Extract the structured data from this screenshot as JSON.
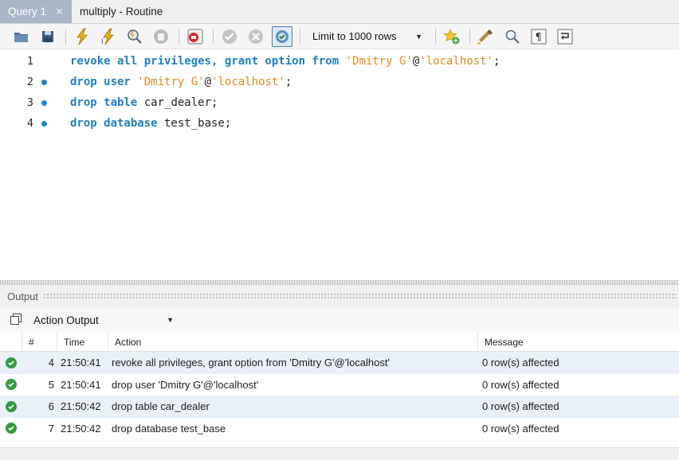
{
  "tabs": [
    {
      "label": "Query 1",
      "active": true
    },
    {
      "label": "multiply - Routine",
      "active": false
    }
  ],
  "toolbar": {
    "limit_select": "Limit to 1000 rows",
    "icons": [
      "folder-open-icon",
      "save-icon",
      "execute-icon",
      "execute-current-icon",
      "explain-icon",
      "stop-icon",
      "toggle-error-stop-icon",
      "commit-icon",
      "rollback-icon",
      "autocommit-icon",
      "add-snippet-icon",
      "beautify-icon",
      "find-icon",
      "invisible-chars-icon",
      "wrap-lines-icon"
    ]
  },
  "editor": {
    "lines": [
      {
        "number": "1",
        "marker": false,
        "tokens": [
          {
            "t": "revoke all privileges, grant option from",
            "c": "kw"
          },
          {
            "t": " ",
            "c": ""
          },
          {
            "t": "'Dmitry G'",
            "c": "str"
          },
          {
            "t": "@",
            "c": ""
          },
          {
            "t": "'localhost'",
            "c": "str"
          },
          {
            "t": ";",
            "c": ""
          }
        ]
      },
      {
        "number": "2",
        "marker": true,
        "tokens": [
          {
            "t": "drop user",
            "c": "kw"
          },
          {
            "t": " ",
            "c": ""
          },
          {
            "t": "'Dmitry G'",
            "c": "str"
          },
          {
            "t": "@",
            "c": ""
          },
          {
            "t": "'localhost'",
            "c": "str"
          },
          {
            "t": ";",
            "c": ""
          }
        ]
      },
      {
        "number": "3",
        "marker": true,
        "tokens": [
          {
            "t": "drop table",
            "c": "kw"
          },
          {
            "t": " car_dealer;",
            "c": ""
          }
        ]
      },
      {
        "number": "4",
        "marker": true,
        "tokens": [
          {
            "t": "drop database",
            "c": "kw"
          },
          {
            "t": " test_base;",
            "c": ""
          }
        ]
      }
    ]
  },
  "output": {
    "title": "Output",
    "view_select": "Action Output",
    "columns": [
      "",
      "#",
      "Time",
      "Action",
      "Message"
    ],
    "rows": [
      {
        "status": "success",
        "num": "4",
        "time": "21:50:41",
        "action": "revoke all privileges, grant option from 'Dmitry G'@'localhost'",
        "message": "0 row(s) affected"
      },
      {
        "status": "success",
        "num": "5",
        "time": "21:50:41",
        "action": "drop user 'Dmitry G'@'localhost'",
        "message": "0 row(s) affected"
      },
      {
        "status": "success",
        "num": "6",
        "time": "21:50:42",
        "action": "drop table car_dealer",
        "message": "0 row(s) affected"
      },
      {
        "status": "success",
        "num": "7",
        "time": "21:50:42",
        "action": "drop database test_base",
        "message": "0 row(s) affected"
      }
    ]
  },
  "colors": {
    "keyword": "#1f7fc2",
    "string": "#e08a1e",
    "line_marker": "#1a86d6",
    "success": "#2e9d3a",
    "active_tab": "#a8b6c6",
    "row_alt": "#e9f0fa"
  }
}
